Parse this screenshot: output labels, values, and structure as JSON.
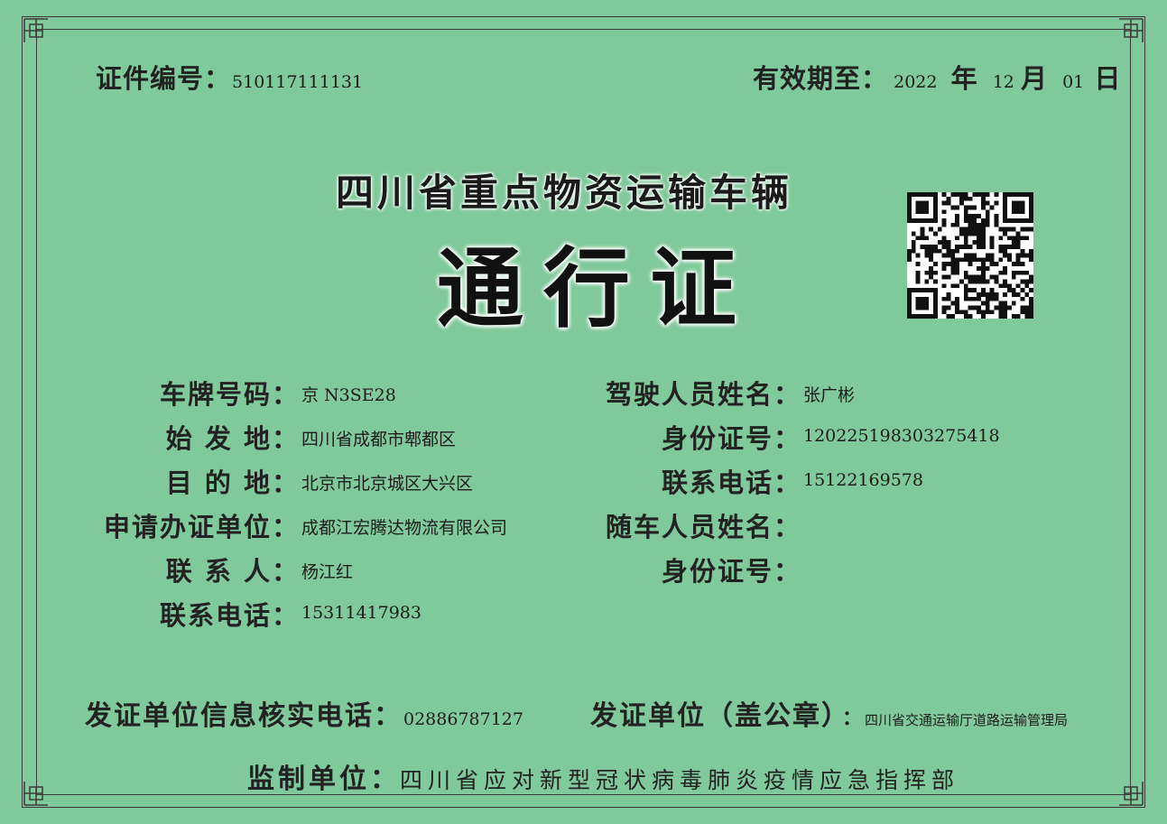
{
  "header": {
    "cert_no_label": "证件编号",
    "cert_no_value": "510117111131",
    "valid_label": "有效期至",
    "valid_year": "2022",
    "year_char": "年",
    "valid_month": "12",
    "month_char": "月",
    "valid_day": "01",
    "day_char": "日"
  },
  "title": {
    "line1": "四川省重点物资运输车辆",
    "line2": "通行证"
  },
  "left_fields": [
    {
      "label": "车牌号码",
      "value": "京 N3SE28"
    },
    {
      "label": "始 发 地",
      "value": "四川省成都市郫都区"
    },
    {
      "label": "目 的 地",
      "value": "北京市北京城区大兴区"
    },
    {
      "label": "申请办证单位",
      "value": "成都江宏腾达物流有限公司"
    },
    {
      "label": "联 系 人",
      "value": "杨江红"
    },
    {
      "label": "联系电话",
      "value": "15311417983"
    }
  ],
  "right_fields": [
    {
      "label": "驾驶人员姓名",
      "value": "张广彬"
    },
    {
      "label": "身份证号",
      "value": "120225198303275418"
    },
    {
      "label": "联系电话",
      "value": "15122169578"
    },
    {
      "label": "随车人员姓名",
      "value": ""
    },
    {
      "label": "身份证号",
      "value": ""
    }
  ],
  "colon": "：",
  "footer": {
    "verify_label": "发证单位信息核实电话",
    "verify_value": "02886787127",
    "issuer_label": "发证单位（盖公章）",
    "issuer_value": "四川省交通运输厅道路运输管理局",
    "supervise_label": "监制单位",
    "supervise_value": "四川省应对新型冠状病毒肺炎疫情应急指挥部"
  },
  "colors": {
    "background": "#80c99b",
    "frame": "#3a3a3a",
    "text": "#1c1c1c"
  },
  "icons": [
    "qr-code-icon",
    "corner-ornament-icon"
  ]
}
